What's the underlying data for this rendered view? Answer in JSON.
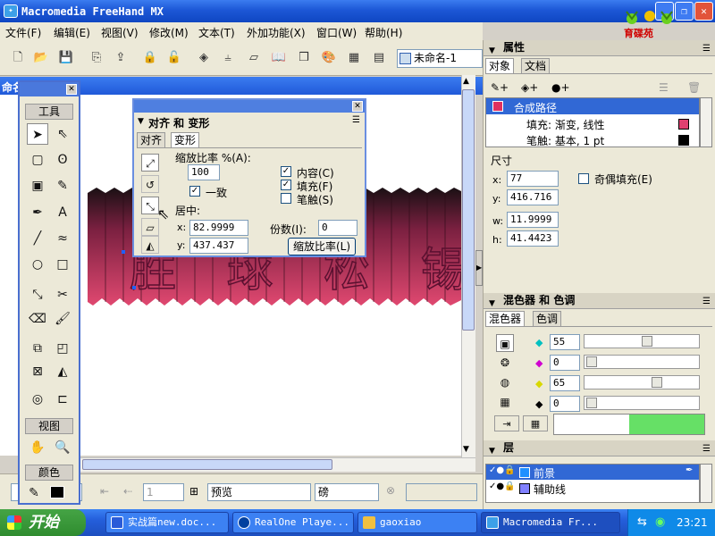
{
  "window": {
    "title": "Macromedia FreeHand MX",
    "logo_text": "育碟苑",
    "minimize": "_",
    "restore": "❐",
    "close": "✕"
  },
  "menu": [
    "文件(F)",
    "编辑(E)",
    "视图(V)",
    "修改(M)",
    "文本(T)",
    "外加功能(X)",
    "窗口(W)",
    "帮助(H)"
  ],
  "toolbar": {
    "doc_name": "未命名-1"
  },
  "canvas": {
    "title": "命名",
    "artwork_text": "胜 球 松 锡"
  },
  "toolbox": {
    "title": "工具",
    "view_label": "视图",
    "color_label": "颜色"
  },
  "transform_panel": {
    "title": "对齐 和 变形",
    "tabs": [
      "对齐",
      "变形"
    ],
    "scale_label": "缩放比率 %(A):",
    "scale_value": "100",
    "uniform_label": "一致",
    "contents_label": "内容(C)",
    "fill_label": "填充(F)",
    "stroke_label": "笔触(S)",
    "center_label": "居中:",
    "x_label": "x:",
    "x_value": "82.9999",
    "y_label": "y:",
    "y_value": "437.437",
    "copies_label": "份数(I):",
    "copies_value": "0",
    "scale_button": "缩放比率(L)"
  },
  "statusbar": {
    "view_mode": "预览",
    "units": "磅",
    "page": "1"
  },
  "properties": {
    "title": "属性",
    "tabs": [
      "对象",
      "文档"
    ],
    "selected_item": "合成路径",
    "fill_row": "填充: 渐变, 线性",
    "stroke_row": "笔触: 基本, 1 pt",
    "dimensions_label": "尺寸",
    "x_label": "x:",
    "x_value": "77",
    "y_label": "y:",
    "y_value": "416.716",
    "w_label": "w:",
    "w_value": "11.9999",
    "h_label": "h:",
    "h_value": "41.4423",
    "even_odd_label": "奇偶填充(E)"
  },
  "mixer": {
    "title": "混色器 和 色调",
    "tabs": [
      "混色器",
      "色调"
    ],
    "channels": [
      {
        "icon": "cyan-diamond",
        "color": "#00c0c0",
        "value": "55"
      },
      {
        "icon": "magenta-diamond",
        "color": "#d000d0",
        "value": "0"
      },
      {
        "icon": "yellow-diamond",
        "color": "#d8d800",
        "value": "65"
      },
      {
        "icon": "black-diamond",
        "color": "#000000",
        "value": "0"
      }
    ],
    "preview_color": "#66e066"
  },
  "layers": {
    "title": "层",
    "items": [
      {
        "name": "前景",
        "color": "#2090ff"
      },
      {
        "name": "辅助线",
        "color": "#8080ff"
      }
    ]
  },
  "taskbar": {
    "start_label": "开始",
    "tasks": [
      "实战篇new.doc...",
      "RealOne Playe...",
      "gaoxiao",
      "Macromedia Fr..."
    ],
    "clock": "23:21"
  }
}
